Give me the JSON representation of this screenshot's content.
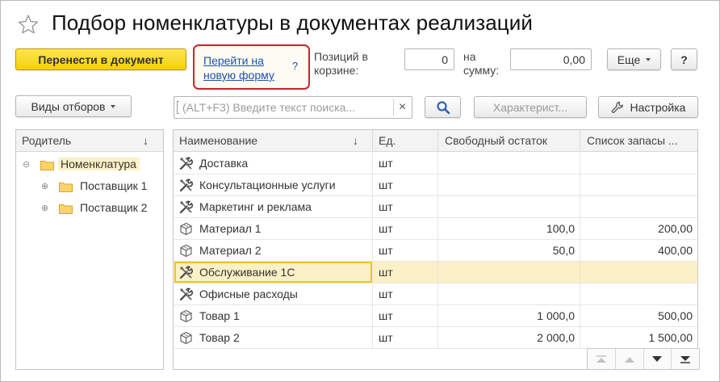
{
  "window": {
    "title": "Подбор номенклатуры в документах реализаций"
  },
  "toolbar": {
    "transfer_label": "Перенести в документ",
    "hint_link": "Перейти на новую форму",
    "hint_question": "?",
    "positions_label": "Позиций в корзине:",
    "positions_value": "0",
    "sum_label": "на сумму:",
    "sum_value": "0,00",
    "more_label": "Еще",
    "help_label": "?"
  },
  "filters": {
    "views_label": "Виды отборов",
    "search_placeholder": "(ALT+F3) Введите текст поиска...",
    "clear_glyph": "×",
    "characteristics_label": "Характерист...",
    "settings_label": "Настройка"
  },
  "tree": {
    "header": "Родитель",
    "sort_glyph": "↓",
    "items": [
      {
        "label": "Номенклатура",
        "toggle": "⊖"
      },
      {
        "label": "Поставщик 1",
        "toggle": "⊕"
      },
      {
        "label": "Поставщик 2",
        "toggle": "⊕"
      }
    ]
  },
  "grid": {
    "columns": {
      "name": "Наименование",
      "name_sort": "↓",
      "unit": "Ед.",
      "free": "Свободный остаток",
      "stock": "Список запасы ..."
    },
    "rows": [
      {
        "icon": "service-icon",
        "name": "Доставка",
        "unit": "шт",
        "free": "",
        "stock": ""
      },
      {
        "icon": "service-icon",
        "name": "Консультационные услуги",
        "unit": "шт",
        "free": "",
        "stock": ""
      },
      {
        "icon": "service-icon",
        "name": "Маркетинг и реклама",
        "unit": "шт",
        "free": "",
        "stock": ""
      },
      {
        "icon": "goods-icon",
        "name": "Материал 1",
        "unit": "шт",
        "free": "100,0",
        "stock": "200,00"
      },
      {
        "icon": "goods-icon",
        "name": "Материал 2",
        "unit": "шт",
        "free": "50,0",
        "stock": "400,00"
      },
      {
        "icon": "service-icon",
        "name": "Обслуживание 1С",
        "unit": "шт",
        "free": "",
        "stock": ""
      },
      {
        "icon": "service-icon",
        "name": "Офисные расходы",
        "unit": "шт",
        "free": "",
        "stock": ""
      },
      {
        "icon": "goods-icon",
        "name": "Товар 1",
        "unit": "шт",
        "free": "1 000,0",
        "stock": "500,00"
      },
      {
        "icon": "goods-icon",
        "name": "Товар 2",
        "unit": "шт",
        "free": "2 000,0",
        "stock": "1 500,00"
      }
    ],
    "selected_row": 5
  },
  "colors": {
    "primary_button": "#f4cf0f",
    "hint_border": "#c8262e",
    "selection": "#fcf0c6",
    "focus": "#f0c419",
    "link": "#1f4fa8"
  }
}
